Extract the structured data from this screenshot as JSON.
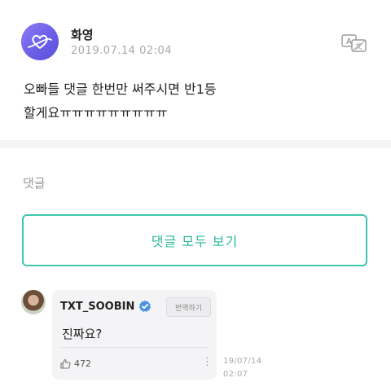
{
  "post": {
    "author": "화영",
    "timestamp": "2019.07.14 02:04",
    "body_line1": "오빠들 댓글 한번만 써주시면 반1등",
    "body_line2": "할게요ㅠㅠㅠㅠㅠㅠㅠㅠㅠ",
    "translate_icon": "translate-icon"
  },
  "comments_section": {
    "label": "댓글",
    "view_all_label": "댓글 모두 보기"
  },
  "comment": {
    "author": "TXT_SOOBIN",
    "verified_icon": "verified-badge-icon",
    "translate_label": "번역하기",
    "text": "진짜요?",
    "likes": "472",
    "more_icon": "⋮",
    "time_line1": "19/07/14",
    "time_line2": "02:07"
  },
  "colors": {
    "accent": "#29b898",
    "avatar_purple": "#6b5fe8",
    "verified_blue": "#4a90e2"
  }
}
